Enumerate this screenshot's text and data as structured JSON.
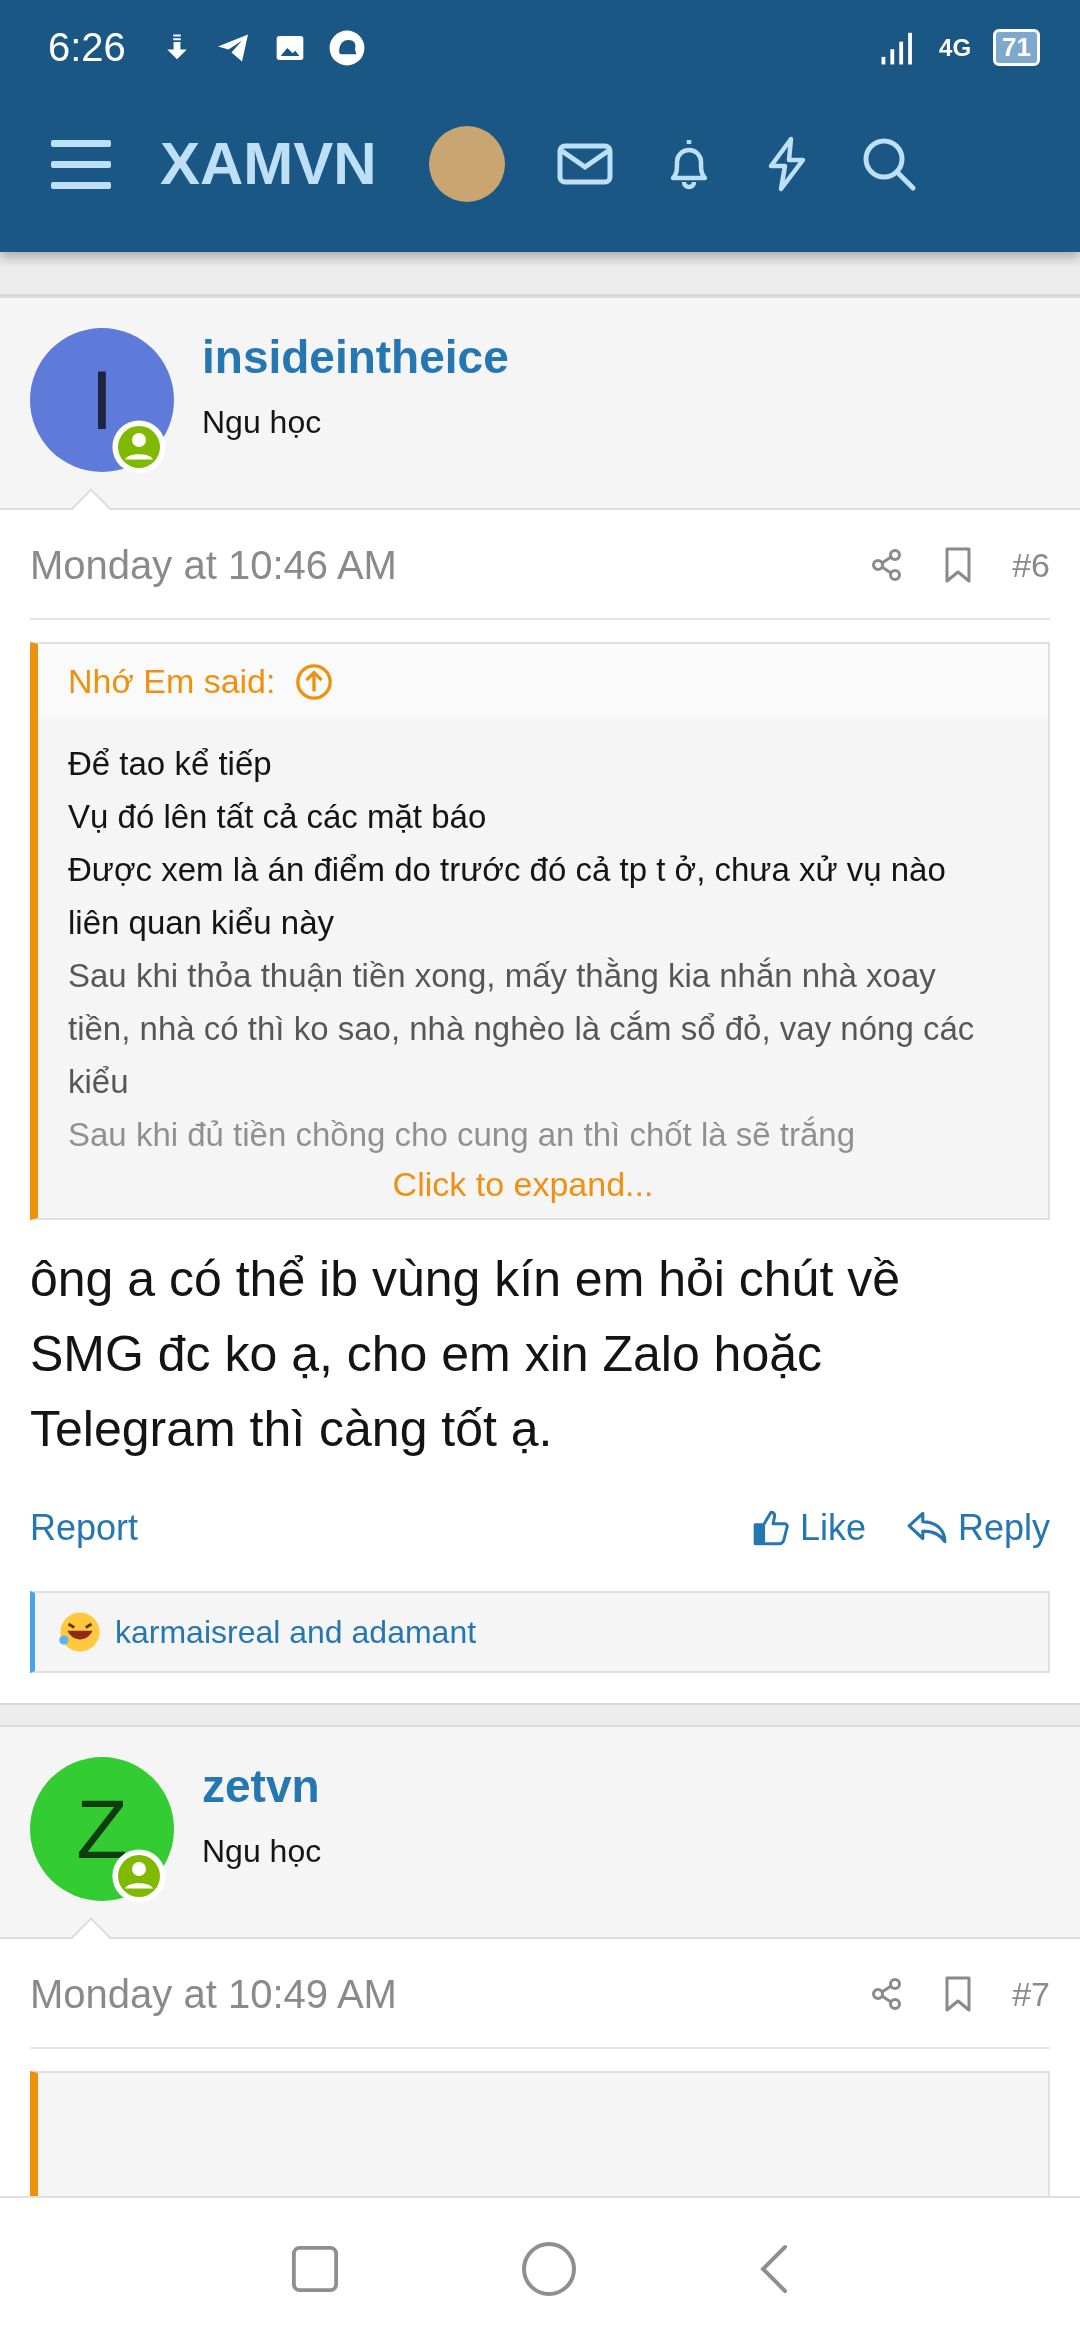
{
  "status_bar": {
    "time": "6:26",
    "network": "4G",
    "battery": "71"
  },
  "header": {
    "logo": "XAMVN"
  },
  "posts": [
    {
      "username": "insideintheice",
      "user_title": "Ngu học",
      "avatar_letter": "I",
      "color": "#5e7bd9",
      "date": "Monday at 10:46 AM",
      "number": "#6",
      "quote": {
        "author": "Nhớ Em said:",
        "lines": [
          "Để tao kể tiếp",
          "Vụ đó lên tất cả các mặt báo",
          "Được xem là án điểm do trước đó cả tp t ở, chưa xử vụ nào liên quan kiểu này",
          "Sau khi thỏa thuận tiền xong, mấy thằng kia nhắn nhà xoay tiền, nhà có thì ko sao, nhà nghèo là cắm sổ đỏ, vay nóng các kiểu",
          "Sau khi đủ tiền chồng cho cung an thì chốt là sẽ trắng"
        ],
        "expand": "Click to expand..."
      },
      "message": "ông a có thể ib vùng kín em hỏi chút về SMG đc ko ạ, cho em xin Zalo hoặc Telegram thì càng tốt ạ.",
      "actions": {
        "report": "Report",
        "like": "Like",
        "reply": "Reply"
      },
      "reactions": "karmaisreal and adamant"
    },
    {
      "username": "zetvn",
      "user_title": "Ngu học",
      "avatar_letter": "Z",
      "color": "#33cc33",
      "date": "Monday at 10:49 AM",
      "number": "#7",
      "quote_start": true
    }
  ]
}
